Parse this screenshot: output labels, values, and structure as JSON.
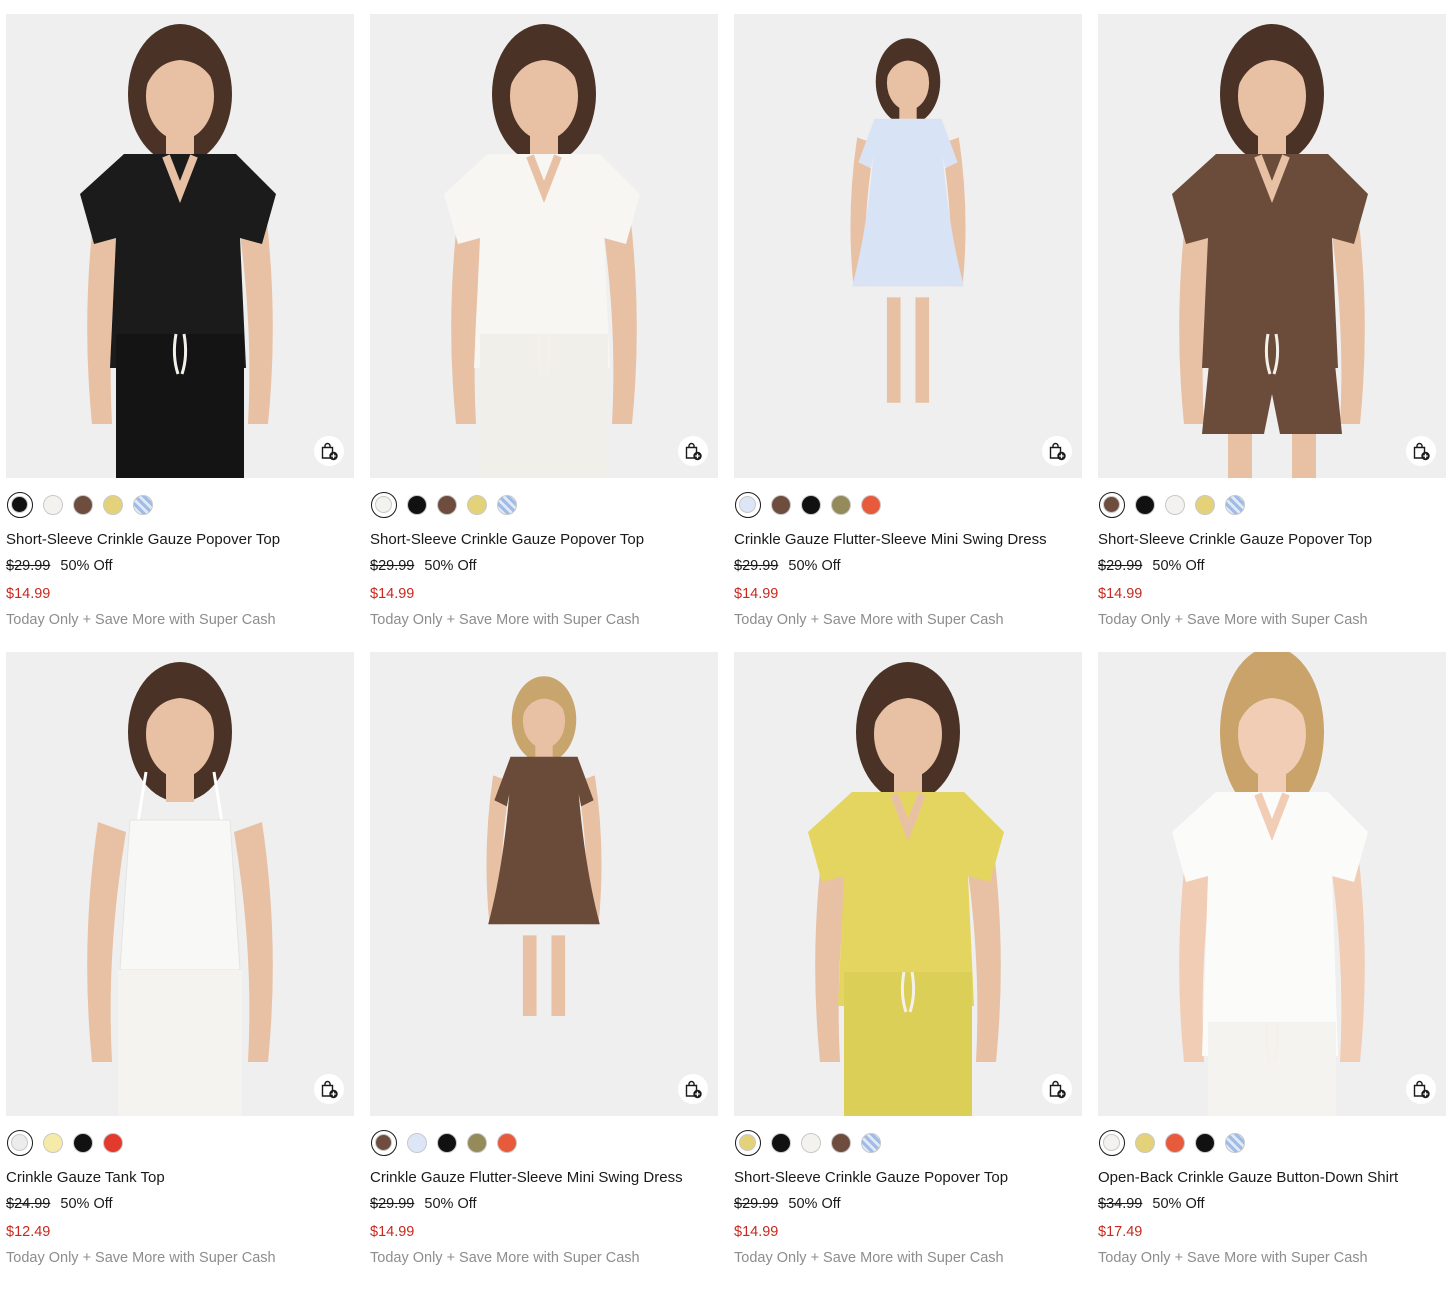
{
  "products": [
    {
      "title": "Short-Sleeve Crinkle Gauze Popover Top",
      "original_price": "$29.99",
      "discount": "50% Off",
      "sale_price": "$14.99",
      "promo": "Today Only + Save More with Super Cash",
      "garment_color": "#1b1b1b",
      "bottom_color": "#141414",
      "style": "top-pants",
      "swatches": [
        "#111111",
        "#f3f2ee",
        "#6e4c3e",
        "#e3d27a",
        "pattern"
      ],
      "selected_swatch": 0
    },
    {
      "title": "Short-Sleeve Crinkle Gauze Popover Top",
      "original_price": "$29.99",
      "discount": "50% Off",
      "sale_price": "$14.99",
      "promo": "Today Only + Save More with Super Cash",
      "garment_color": "#f7f6f2",
      "bottom_color": "#f1efe9",
      "style": "top-pants",
      "swatches": [
        "#f3f2ee",
        "#111111",
        "#6e4c3e",
        "#e3d27a",
        "pattern"
      ],
      "selected_swatch": 0
    },
    {
      "title": "Crinkle Gauze Flutter-Sleeve Mini Swing Dress",
      "original_price": "$29.99",
      "discount": "50% Off",
      "sale_price": "$14.99",
      "promo": "Today Only + Save More with Super Cash",
      "garment_color": "#d9e3f6",
      "bottom_color": "#d9e3f6",
      "style": "dress",
      "swatches": [
        "#dde6f7",
        "#6e4c3e",
        "#111111",
        "#958a5a",
        "#e85a3c"
      ],
      "selected_swatch": 0
    },
    {
      "title": "Short-Sleeve Crinkle Gauze Popover Top",
      "original_price": "$29.99",
      "discount": "50% Off",
      "sale_price": "$14.99",
      "promo": "Today Only + Save More with Super Cash",
      "garment_color": "#6b4c3b",
      "bottom_color": "#6b4c3b",
      "style": "top-shorts",
      "swatches": [
        "#6e4c3e",
        "#111111",
        "#f3f2ee",
        "#e3d27a",
        "pattern"
      ],
      "selected_swatch": 0
    },
    {
      "title": "Crinkle Gauze Tank Top",
      "original_price": "$24.99",
      "discount": "50% Off",
      "sale_price": "$12.49",
      "promo": "Today Only + Save More with Super Cash",
      "garment_color": "#f8f8f6",
      "bottom_color": "#f4f3ef",
      "style": "tank-pants",
      "swatches": [
        "#ececec",
        "#f5eaa8",
        "#111111",
        "#e23b2e"
      ],
      "selected_swatch": 0
    },
    {
      "title": "Crinkle Gauze Flutter-Sleeve Mini Swing Dress",
      "original_price": "$29.99",
      "discount": "50% Off",
      "sale_price": "$14.99",
      "promo": "Today Only + Save More with Super Cash",
      "garment_color": "#6a4a38",
      "bottom_color": "#6a4a38",
      "style": "dress-long",
      "swatches": [
        "#6e4c3e",
        "#dde6f7",
        "#111111",
        "#958a5a",
        "#e85a3c"
      ],
      "selected_swatch": 0
    },
    {
      "title": "Short-Sleeve Crinkle Gauze Popover Top",
      "original_price": "$29.99",
      "discount": "50% Off",
      "sale_price": "$14.99",
      "promo": "Today Only + Save More with Super Cash",
      "garment_color": "#e3d560",
      "bottom_color": "#dccf58",
      "style": "top-pants",
      "swatches": [
        "#e3d27a",
        "#111111",
        "#f3f2ee",
        "#6e4c3e",
        "pattern"
      ],
      "selected_swatch": 0
    },
    {
      "title": "Open-Back Crinkle Gauze Button-Down Shirt",
      "original_price": "$34.99",
      "discount": "50% Off",
      "sale_price": "$17.49",
      "promo": "Today Only + Save More with Super Cash",
      "garment_color": "#fbfbfa",
      "bottom_color": "#f4f3f0",
      "style": "shirt-pants",
      "swatches": [
        "#f3f2ee",
        "#e3d27a",
        "#e85a3c",
        "#111111",
        "pattern"
      ],
      "selected_swatch": 0
    }
  ]
}
